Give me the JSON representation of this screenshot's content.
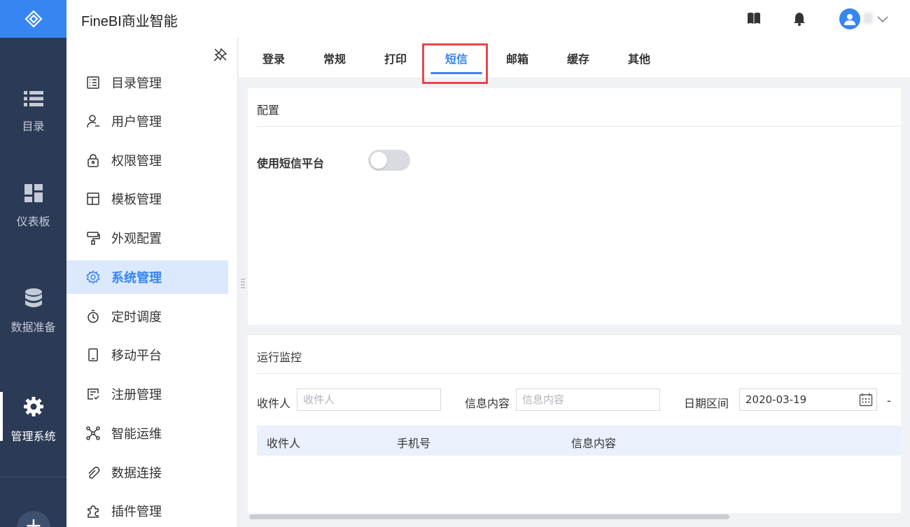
{
  "app": {
    "title": "FineBI商业智能"
  },
  "rail": {
    "items": [
      {
        "label": "目录",
        "icon": "list-icon"
      },
      {
        "label": "仪表板",
        "icon": "dashboard-icon"
      },
      {
        "label": "数据准备",
        "icon": "database-icon"
      },
      {
        "label": "管理系统",
        "icon": "gear-icon",
        "active": true
      }
    ],
    "plus": "+"
  },
  "sidebar": {
    "items": [
      {
        "label": "目录管理",
        "icon": "catalog-icon"
      },
      {
        "label": "用户管理",
        "icon": "user-icon"
      },
      {
        "label": "权限管理",
        "icon": "lock-icon"
      },
      {
        "label": "模板管理",
        "icon": "template-icon"
      },
      {
        "label": "外观配置",
        "icon": "brush-icon"
      },
      {
        "label": "系统管理",
        "icon": "gear-icon",
        "active": true
      },
      {
        "label": "定时调度",
        "icon": "timer-icon"
      },
      {
        "label": "移动平台",
        "icon": "mobile-icon"
      },
      {
        "label": "注册管理",
        "icon": "register-icon"
      },
      {
        "label": "智能运维",
        "icon": "network-icon"
      },
      {
        "label": "数据连接",
        "icon": "link-icon"
      },
      {
        "label": "插件管理",
        "icon": "plugin-icon"
      }
    ]
  },
  "tabs": [
    {
      "label": "登录"
    },
    {
      "label": "常规"
    },
    {
      "label": "打印"
    },
    {
      "label": "短信",
      "active": true
    },
    {
      "label": "邮箱"
    },
    {
      "label": "缓存"
    },
    {
      "label": "其他"
    }
  ],
  "config": {
    "title": "配置",
    "sms_platform_label": "使用短信平台",
    "sms_platform_enabled": false
  },
  "monitor": {
    "title": "运行监控",
    "recipient_label": "收件人",
    "recipient_placeholder": "收件人",
    "content_label": "信息内容",
    "content_placeholder": "信息内容",
    "date_label": "日期区间",
    "date_start": "2020-03-19",
    "date_sep": "-",
    "table_headers": [
      "收件人",
      "手机号",
      "信息内容"
    ]
  },
  "colors": {
    "primary": "#3685f2",
    "rail": "#2b3a55",
    "highlight": "#e5484d"
  }
}
